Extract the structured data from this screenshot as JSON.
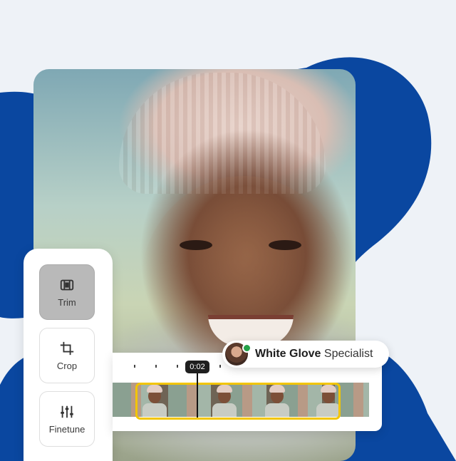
{
  "tools": [
    {
      "label": "Trim",
      "icon": "trim-icon",
      "active": true
    },
    {
      "label": "Crop",
      "icon": "crop-icon",
      "active": false
    },
    {
      "label": "Finetune",
      "icon": "finetune-icon",
      "active": false
    }
  ],
  "timeline": {
    "playhead_time": "0:02"
  },
  "badge": {
    "name_bold": "White Glove",
    "name_rest": "Specialist",
    "status_color": "#24a148"
  },
  "colors": {
    "brand_blue": "#0a47a0",
    "selection": "#f2c500"
  }
}
